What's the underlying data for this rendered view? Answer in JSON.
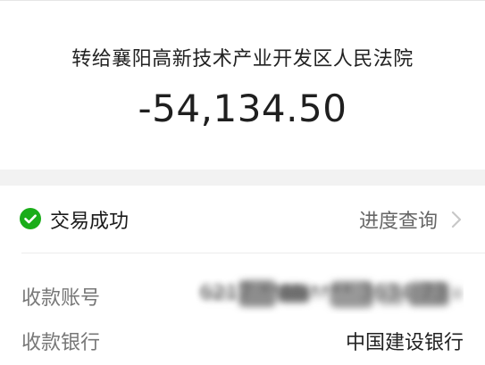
{
  "transfer": {
    "recipient_title": "转给襄阳高新技术产业开发区人民法院",
    "amount": "-54,134.50"
  },
  "status": {
    "text": "交易成功",
    "icon": "check-circle-icon",
    "color": "#1aad19"
  },
  "progress": {
    "label": "进度查询",
    "icon": "chevron-right-icon"
  },
  "details": {
    "account_label": "收款账号",
    "account_value": "6217 **** **** 3634 73",
    "bank_label": "收款银行",
    "bank_value": "中国建设银行"
  }
}
